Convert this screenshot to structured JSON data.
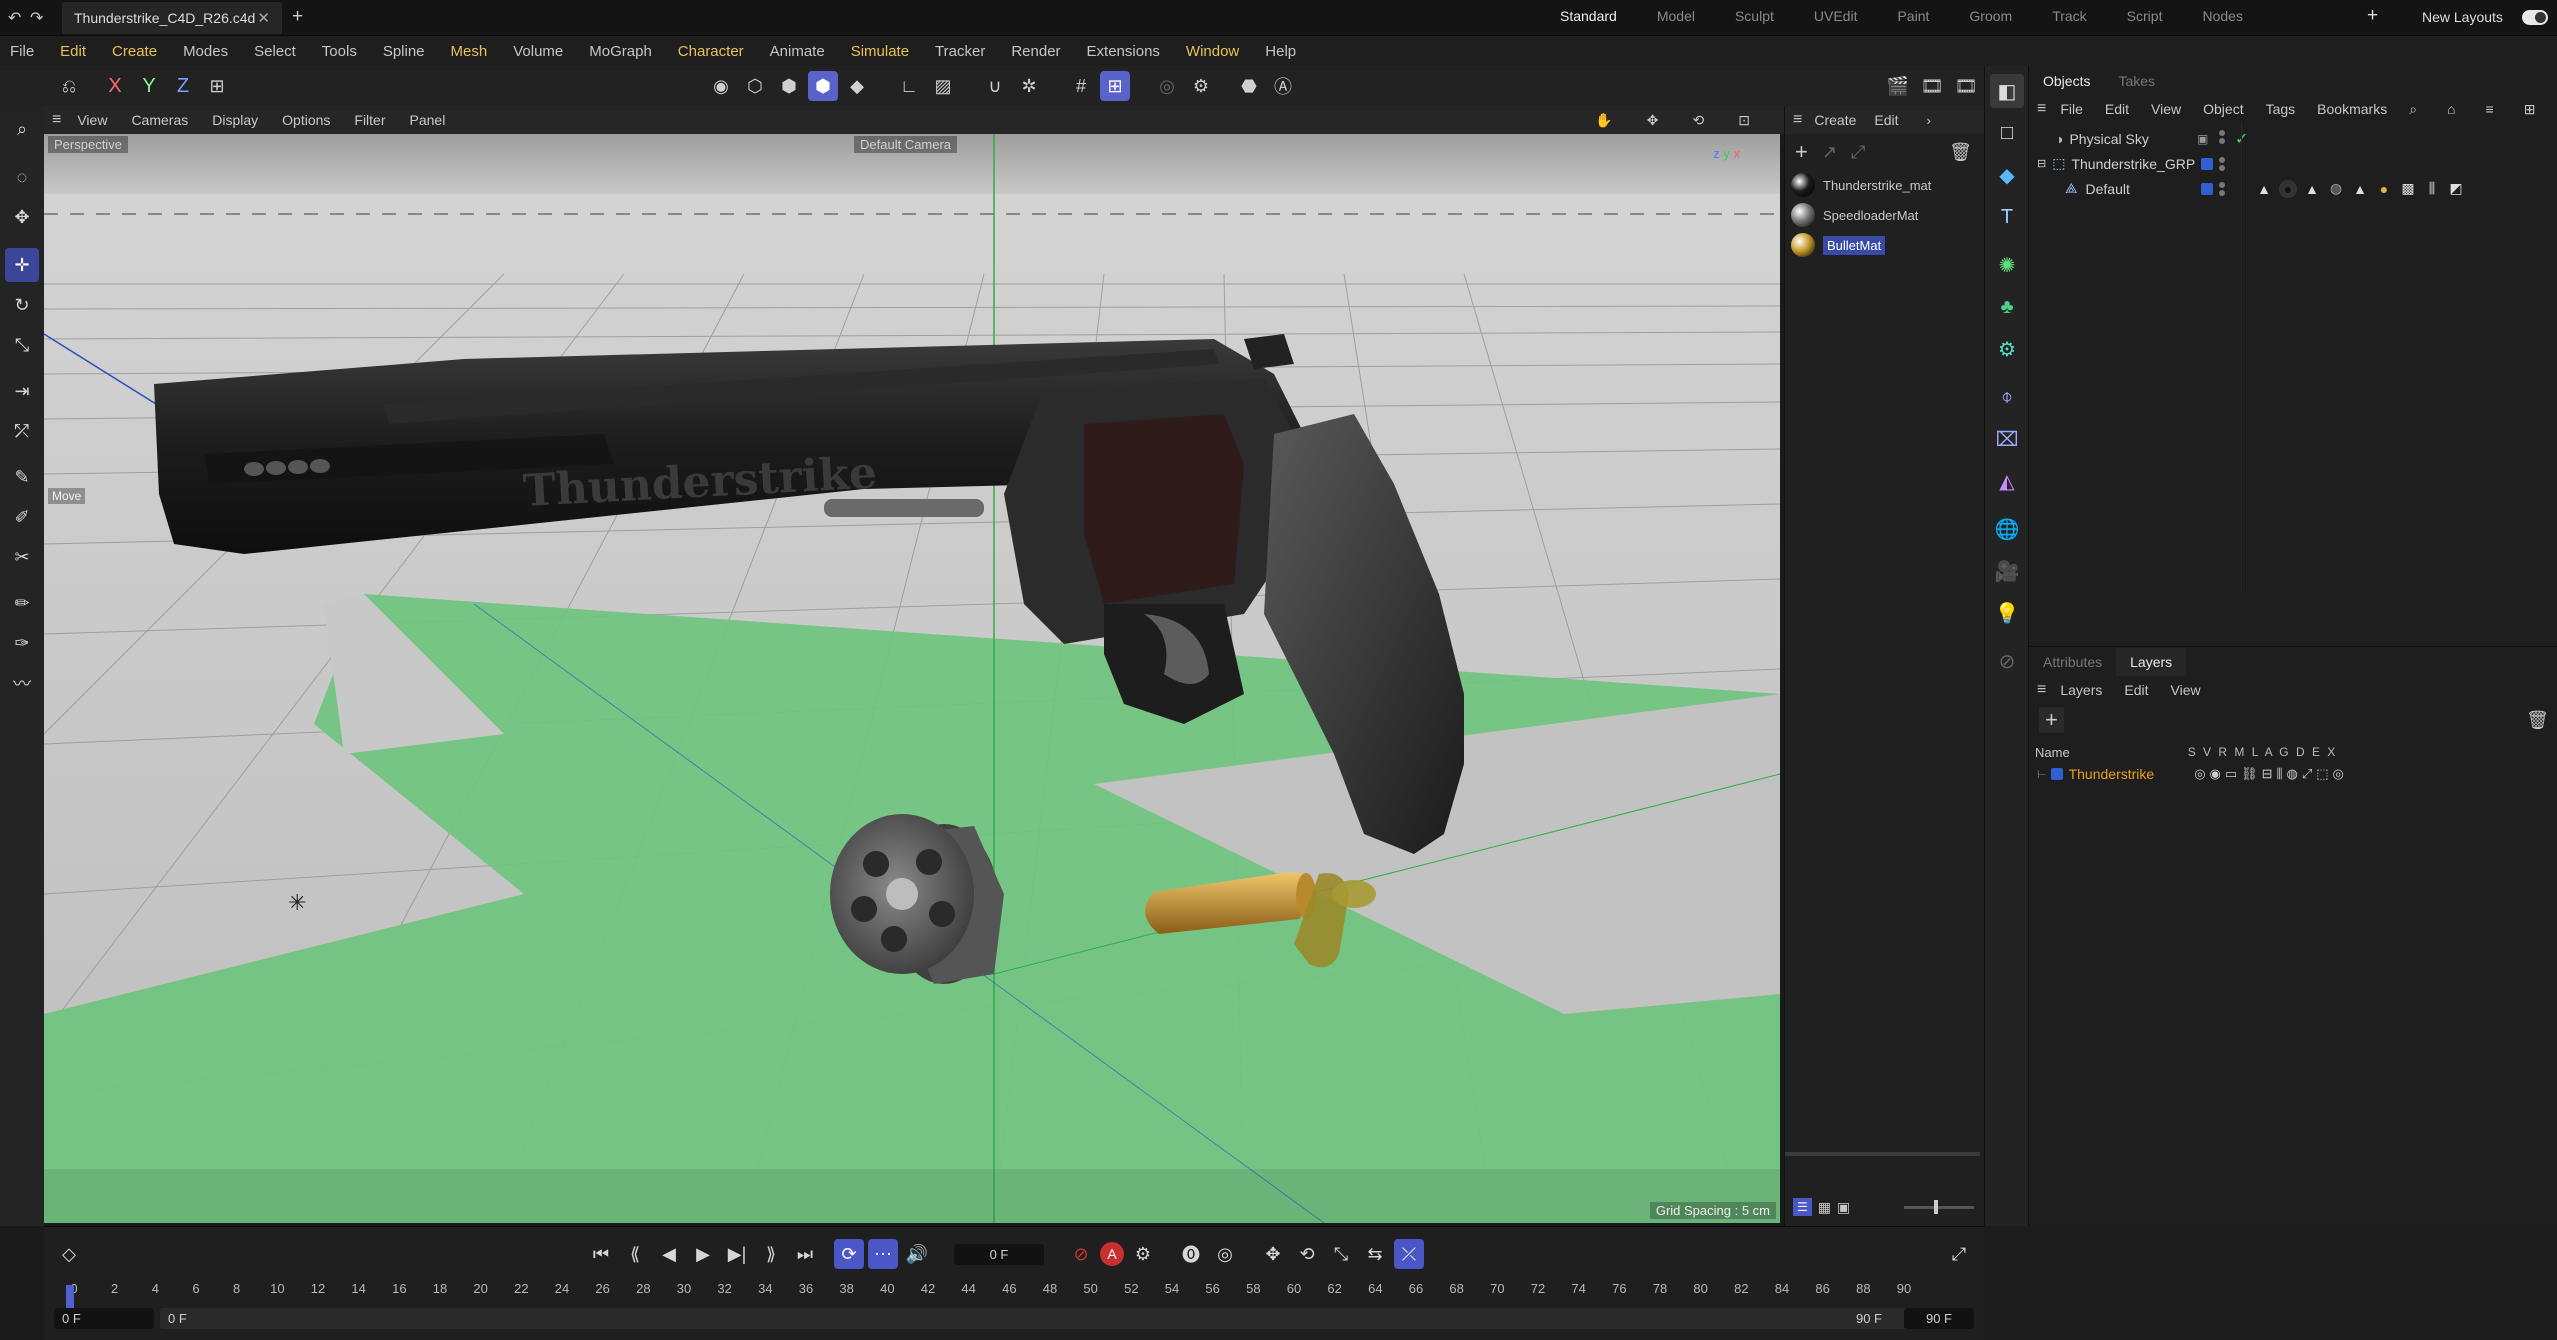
{
  "tab": {
    "title": "Thunderstrike_C4D_R26.c4d",
    "new": "+"
  },
  "layouts": {
    "items": [
      "Standard",
      "Model",
      "Sculpt",
      "UVEdit",
      "Paint",
      "Groom",
      "Track",
      "Script",
      "Nodes"
    ],
    "active": "Standard",
    "new_label": "New Layouts",
    "add": "+"
  },
  "menu": [
    "File",
    "Edit",
    "Create",
    "Modes",
    "Select",
    "Tools",
    "Spline",
    "Mesh",
    "Volume",
    "MoGraph",
    "Character",
    "Animate",
    "Simulate",
    "Tracker",
    "Render",
    "Extensions",
    "Window",
    "Help"
  ],
  "axis": {
    "x": "X",
    "y": "Y",
    "z": "Z"
  },
  "viewport": {
    "menu": [
      "View",
      "Cameras",
      "Display",
      "Options",
      "Filter",
      "Panel"
    ],
    "perspective": "Perspective",
    "camera": "Default Camera",
    "grid_spacing": "Grid Spacing : 5 cm",
    "move_label": "Move",
    "engraving": "Thunderstrike"
  },
  "materials": {
    "menu": [
      "Create",
      "Edit"
    ],
    "items": [
      {
        "name": "Thunderstrike_mat",
        "color": "#1a1a1a"
      },
      {
        "name": "SpeedloaderMat",
        "color": "#777777"
      },
      {
        "name": "BulletMat",
        "color": "#c79a2a"
      }
    ],
    "selected": "BulletMat"
  },
  "objects": {
    "tabs": [
      "Objects",
      "Takes"
    ],
    "menu": [
      "File",
      "Edit",
      "View",
      "Object",
      "Tags",
      "Bookmarks"
    ],
    "items": [
      "Physical Sky",
      "Thunderstrike_GRP",
      "Default"
    ]
  },
  "layers": {
    "tabs": [
      "Attributes",
      "Layers"
    ],
    "menu": [
      "Layers",
      "Edit",
      "View"
    ],
    "name_header": "Name",
    "flags": "S V R M L A G D E X",
    "items": [
      {
        "name": "Thunderstrike",
        "color": "#e8a01a"
      }
    ]
  },
  "timeline": {
    "current_frame": "0 F",
    "start": "0 F",
    "start2": "0 F",
    "end": "90 F",
    "end2": "90 F",
    "ticks": [
      "0",
      "2",
      "4",
      "6",
      "8",
      "10",
      "12",
      "14",
      "16",
      "18",
      "20",
      "22",
      "24",
      "26",
      "28",
      "30",
      "32",
      "34",
      "36",
      "38",
      "40",
      "42",
      "44",
      "46",
      "48",
      "50",
      "52",
      "54",
      "56",
      "58",
      "60",
      "62",
      "64",
      "66",
      "68",
      "70",
      "72",
      "74",
      "76",
      "78",
      "80",
      "82",
      "84",
      "86",
      "88",
      "90"
    ]
  },
  "colors": {
    "accent": "#5a63c9",
    "highlight_menu": "#e8c15a",
    "ground": "#6fc47f"
  }
}
